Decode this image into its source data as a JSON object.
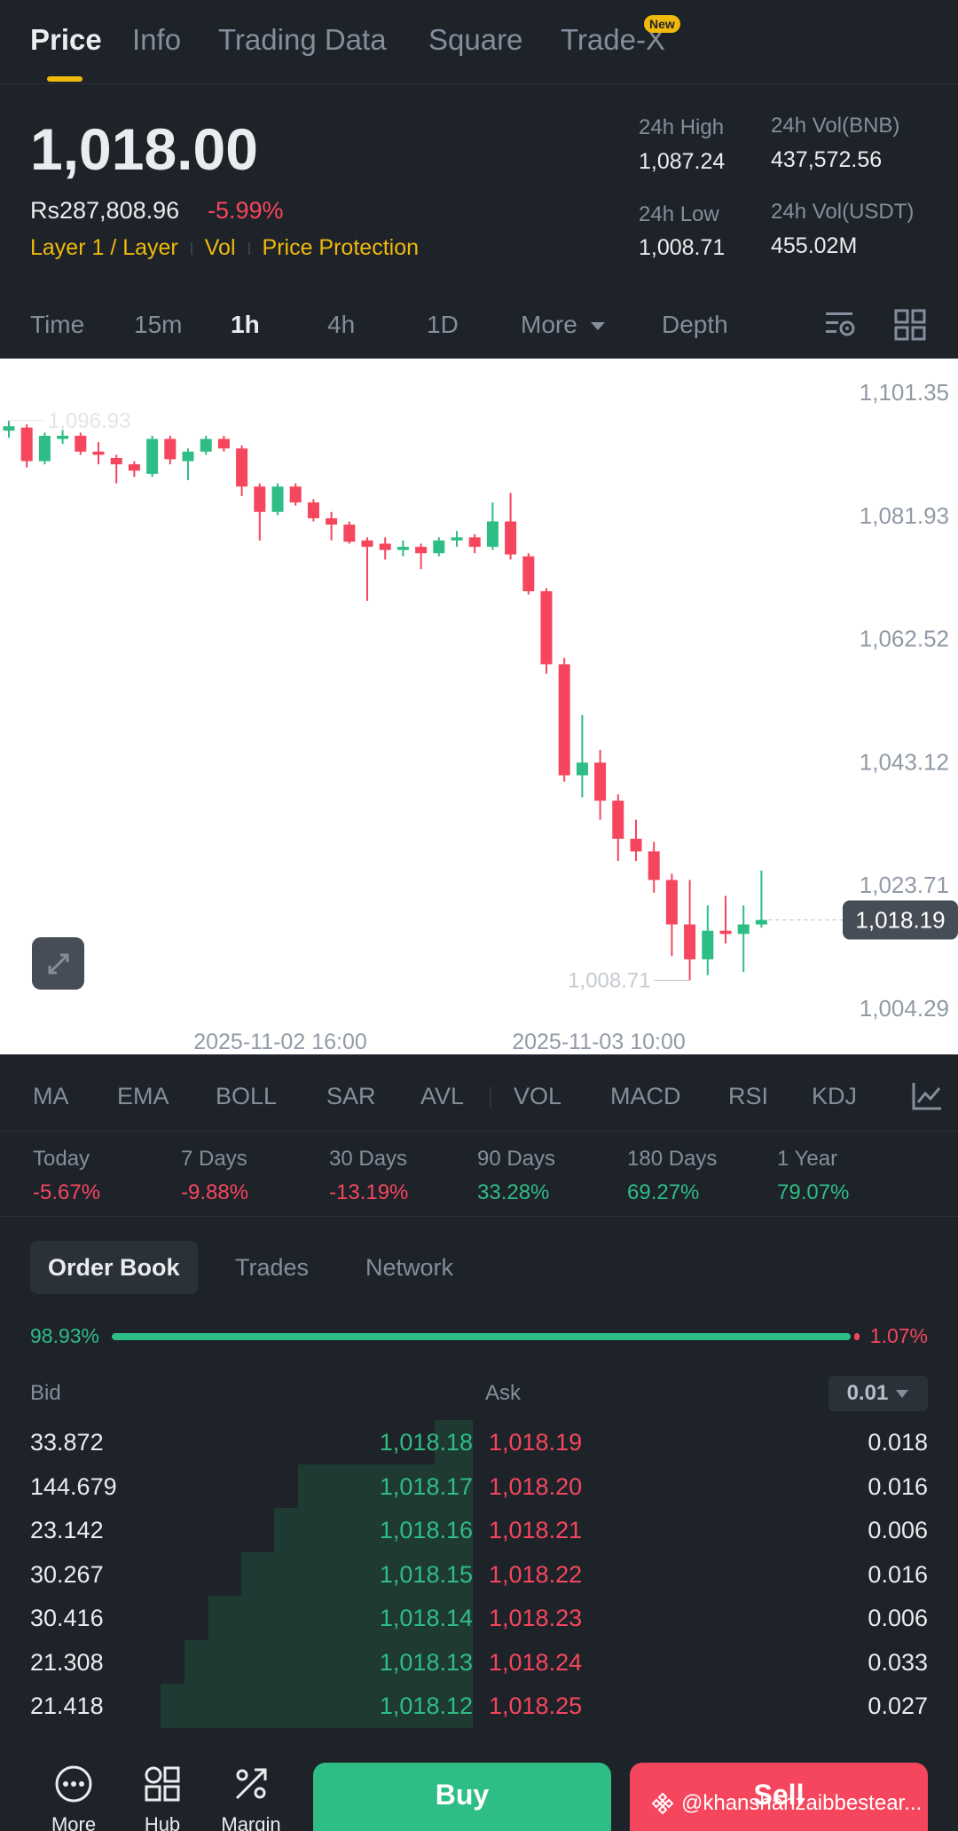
{
  "top_tabs": [
    {
      "label": "Price"
    },
    {
      "label": "Info"
    },
    {
      "label": "Trading Data"
    },
    {
      "label": "Square"
    },
    {
      "label": "Trade-X"
    }
  ],
  "new_badge": "New",
  "price": {
    "last": "1,018.00",
    "fiat": "Rs287,808.96",
    "change_pct": "-5.99%",
    "tags": [
      "Layer 1 / Layer",
      "Vol",
      "Price Protection"
    ]
  },
  "stats": {
    "high_label": "24h High",
    "high_value": "1,087.24",
    "low_label": "24h Low",
    "low_value": "1,008.71",
    "vol_base_label": "24h Vol(BNB)",
    "vol_base_value": "437,572.56",
    "vol_quote_label": "24h Vol(USDT)",
    "vol_quote_value": "455.02M"
  },
  "intervals": [
    "Time",
    "15m",
    "1h",
    "4h",
    "1D",
    "More",
    "Depth"
  ],
  "chart_data": {
    "type": "candlestick",
    "y_ticks": [
      "1,101.35",
      "1,081.93",
      "1,062.52",
      "1,043.12",
      "1,023.71",
      "1,004.29"
    ],
    "ylim": [
      1004.29,
      1101.35
    ],
    "x_labels": [
      "2025-11-02 16:00",
      "2025-11-03 10:00"
    ],
    "current_price_label": "1,018.19",
    "high_marker": "1,096.93",
    "low_marker": "1,008.71",
    "candles": [
      {
        "o": 1095.3,
        "h": 1096.9,
        "l": 1094.2,
        "c": 1096.0
      },
      {
        "o": 1095.8,
        "h": 1096.3,
        "l": 1089.5,
        "c": 1090.5
      },
      {
        "o": 1090.5,
        "h": 1095.0,
        "l": 1090.0,
        "c": 1094.5
      },
      {
        "o": 1094.0,
        "h": 1095.5,
        "l": 1093.2,
        "c": 1094.5
      },
      {
        "o": 1094.5,
        "h": 1095.0,
        "l": 1091.5,
        "c": 1092.0
      },
      {
        "o": 1092.0,
        "h": 1093.5,
        "l": 1090.0,
        "c": 1091.5
      },
      {
        "o": 1091.0,
        "h": 1091.5,
        "l": 1087.0,
        "c": 1090.0
      },
      {
        "o": 1090.0,
        "h": 1090.5,
        "l": 1088.0,
        "c": 1089.0
      },
      {
        "o": 1088.5,
        "h": 1094.5,
        "l": 1088.0,
        "c": 1094.0
      },
      {
        "o": 1094.0,
        "h": 1094.5,
        "l": 1090.0,
        "c": 1090.8
      },
      {
        "o": 1090.5,
        "h": 1092.5,
        "l": 1087.5,
        "c": 1092.0
      },
      {
        "o": 1092.0,
        "h": 1094.5,
        "l": 1091.5,
        "c": 1094.0
      },
      {
        "o": 1094.0,
        "h": 1094.5,
        "l": 1092.0,
        "c": 1092.5
      },
      {
        "o": 1092.5,
        "h": 1093.0,
        "l": 1085.0,
        "c": 1086.5
      },
      {
        "o": 1086.5,
        "h": 1087.0,
        "l": 1078.0,
        "c": 1082.5
      },
      {
        "o": 1082.5,
        "h": 1087.0,
        "l": 1082.0,
        "c": 1086.5
      },
      {
        "o": 1086.5,
        "h": 1087.0,
        "l": 1083.5,
        "c": 1084.0
      },
      {
        "o": 1084.0,
        "h": 1084.5,
        "l": 1081.0,
        "c": 1081.5
      },
      {
        "o": 1081.5,
        "h": 1082.5,
        "l": 1078.0,
        "c": 1080.5
      },
      {
        "o": 1080.5,
        "h": 1081.0,
        "l": 1077.5,
        "c": 1077.8
      },
      {
        "o": 1078.0,
        "h": 1078.5,
        "l": 1068.5,
        "c": 1077.0
      },
      {
        "o": 1077.5,
        "h": 1078.5,
        "l": 1075.0,
        "c": 1076.5
      },
      {
        "o": 1076.5,
        "h": 1078.0,
        "l": 1075.5,
        "c": 1077.0
      },
      {
        "o": 1077.0,
        "h": 1077.5,
        "l": 1073.5,
        "c": 1076.0
      },
      {
        "o": 1076.0,
        "h": 1078.5,
        "l": 1075.5,
        "c": 1078.0
      },
      {
        "o": 1078.0,
        "h": 1079.5,
        "l": 1077.0,
        "c": 1078.5
      },
      {
        "o": 1078.5,
        "h": 1079.0,
        "l": 1076.0,
        "c": 1077.0
      },
      {
        "o": 1077.0,
        "h": 1084.0,
        "l": 1076.5,
        "c": 1081.0
      },
      {
        "o": 1081.0,
        "h": 1085.5,
        "l": 1075.0,
        "c": 1075.8
      },
      {
        "o": 1075.5,
        "h": 1076.0,
        "l": 1069.5,
        "c": 1070.0
      },
      {
        "o": 1070.0,
        "h": 1070.5,
        "l": 1057.0,
        "c": 1058.5
      },
      {
        "o": 1058.5,
        "h": 1059.5,
        "l": 1040.0,
        "c": 1041.0
      },
      {
        "o": 1041.0,
        "h": 1050.5,
        "l": 1037.5,
        "c": 1043.0
      },
      {
        "o": 1043.0,
        "h": 1045.0,
        "l": 1034.0,
        "c": 1037.0
      },
      {
        "o": 1037.0,
        "h": 1038.0,
        "l": 1027.5,
        "c": 1031.0
      },
      {
        "o": 1031.0,
        "h": 1034.0,
        "l": 1027.5,
        "c": 1029.0
      },
      {
        "o": 1029.0,
        "h": 1030.5,
        "l": 1022.5,
        "c": 1024.5
      },
      {
        "o": 1024.5,
        "h": 1025.5,
        "l": 1012.5,
        "c": 1017.5
      },
      {
        "o": 1017.5,
        "h": 1024.5,
        "l": 1008.7,
        "c": 1012.0
      },
      {
        "o": 1012.0,
        "h": 1020.5,
        "l": 1009.5,
        "c": 1016.5
      },
      {
        "o": 1016.5,
        "h": 1022.0,
        "l": 1014.5,
        "c": 1016.0
      },
      {
        "o": 1016.0,
        "h": 1020.5,
        "l": 1010.0,
        "c": 1017.5
      },
      {
        "o": 1017.5,
        "h": 1026.0,
        "l": 1017.0,
        "c": 1018.2
      }
    ],
    "colors": {
      "up": "#2ebd85",
      "down": "#f6465d",
      "axis_text": "#929aa5"
    }
  },
  "indicators": [
    "MA",
    "EMA",
    "BOLL",
    "SAR",
    "AVL",
    "VOL",
    "MACD",
    "RSI",
    "KDJ"
  ],
  "performance": [
    {
      "label": "Today",
      "value": "-5.67%"
    },
    {
      "label": "7 Days",
      "value": "-9.88%"
    },
    {
      "label": "30 Days",
      "value": "-13.19%"
    },
    {
      "label": "90 Days",
      "value": "33.28%"
    },
    {
      "label": "180 Days",
      "value": "69.27%"
    },
    {
      "label": "1 Year",
      "value": "79.07%"
    }
  ],
  "book_tabs": [
    "Order Book",
    "Trades",
    "Network"
  ],
  "ratio": {
    "bid_pct": "98.93%",
    "ask_pct": "1.07%",
    "bid_fraction": 0.9893
  },
  "book": {
    "bid_header": "Bid",
    "ask_header": "Ask",
    "precision": "0.01",
    "rows": [
      {
        "bid_qty": "33.872",
        "bid_price": "1,018.18",
        "ask_price": "1,018.19",
        "ask_qty": "0.018",
        "depth": 0.08
      },
      {
        "bid_qty": "144.679",
        "bid_price": "1,018.17",
        "ask_price": "1,018.20",
        "ask_qty": "0.016",
        "depth": 0.37
      },
      {
        "bid_qty": "23.142",
        "bid_price": "1,018.16",
        "ask_price": "1,018.21",
        "ask_qty": "0.006",
        "depth": 0.42
      },
      {
        "bid_qty": "30.267",
        "bid_price": "1,018.15",
        "ask_price": "1,018.22",
        "ask_qty": "0.016",
        "depth": 0.49
      },
      {
        "bid_qty": "30.416",
        "bid_price": "1,018.14",
        "ask_price": "1,018.23",
        "ask_qty": "0.006",
        "depth": 0.56
      },
      {
        "bid_qty": "21.308",
        "bid_price": "1,018.13",
        "ask_price": "1,018.24",
        "ask_qty": "0.033",
        "depth": 0.61
      },
      {
        "bid_qty": "21.418",
        "bid_price": "1,018.12",
        "ask_price": "1,018.25",
        "ask_qty": "0.027",
        "depth": 0.66
      }
    ]
  },
  "bottom": {
    "more_label": "More",
    "hub_label": "Hub",
    "margin_label": "Margin",
    "buy_label": "Buy",
    "sell_label": "Sell",
    "watermark": "@khanshahzaibbestear..."
  }
}
